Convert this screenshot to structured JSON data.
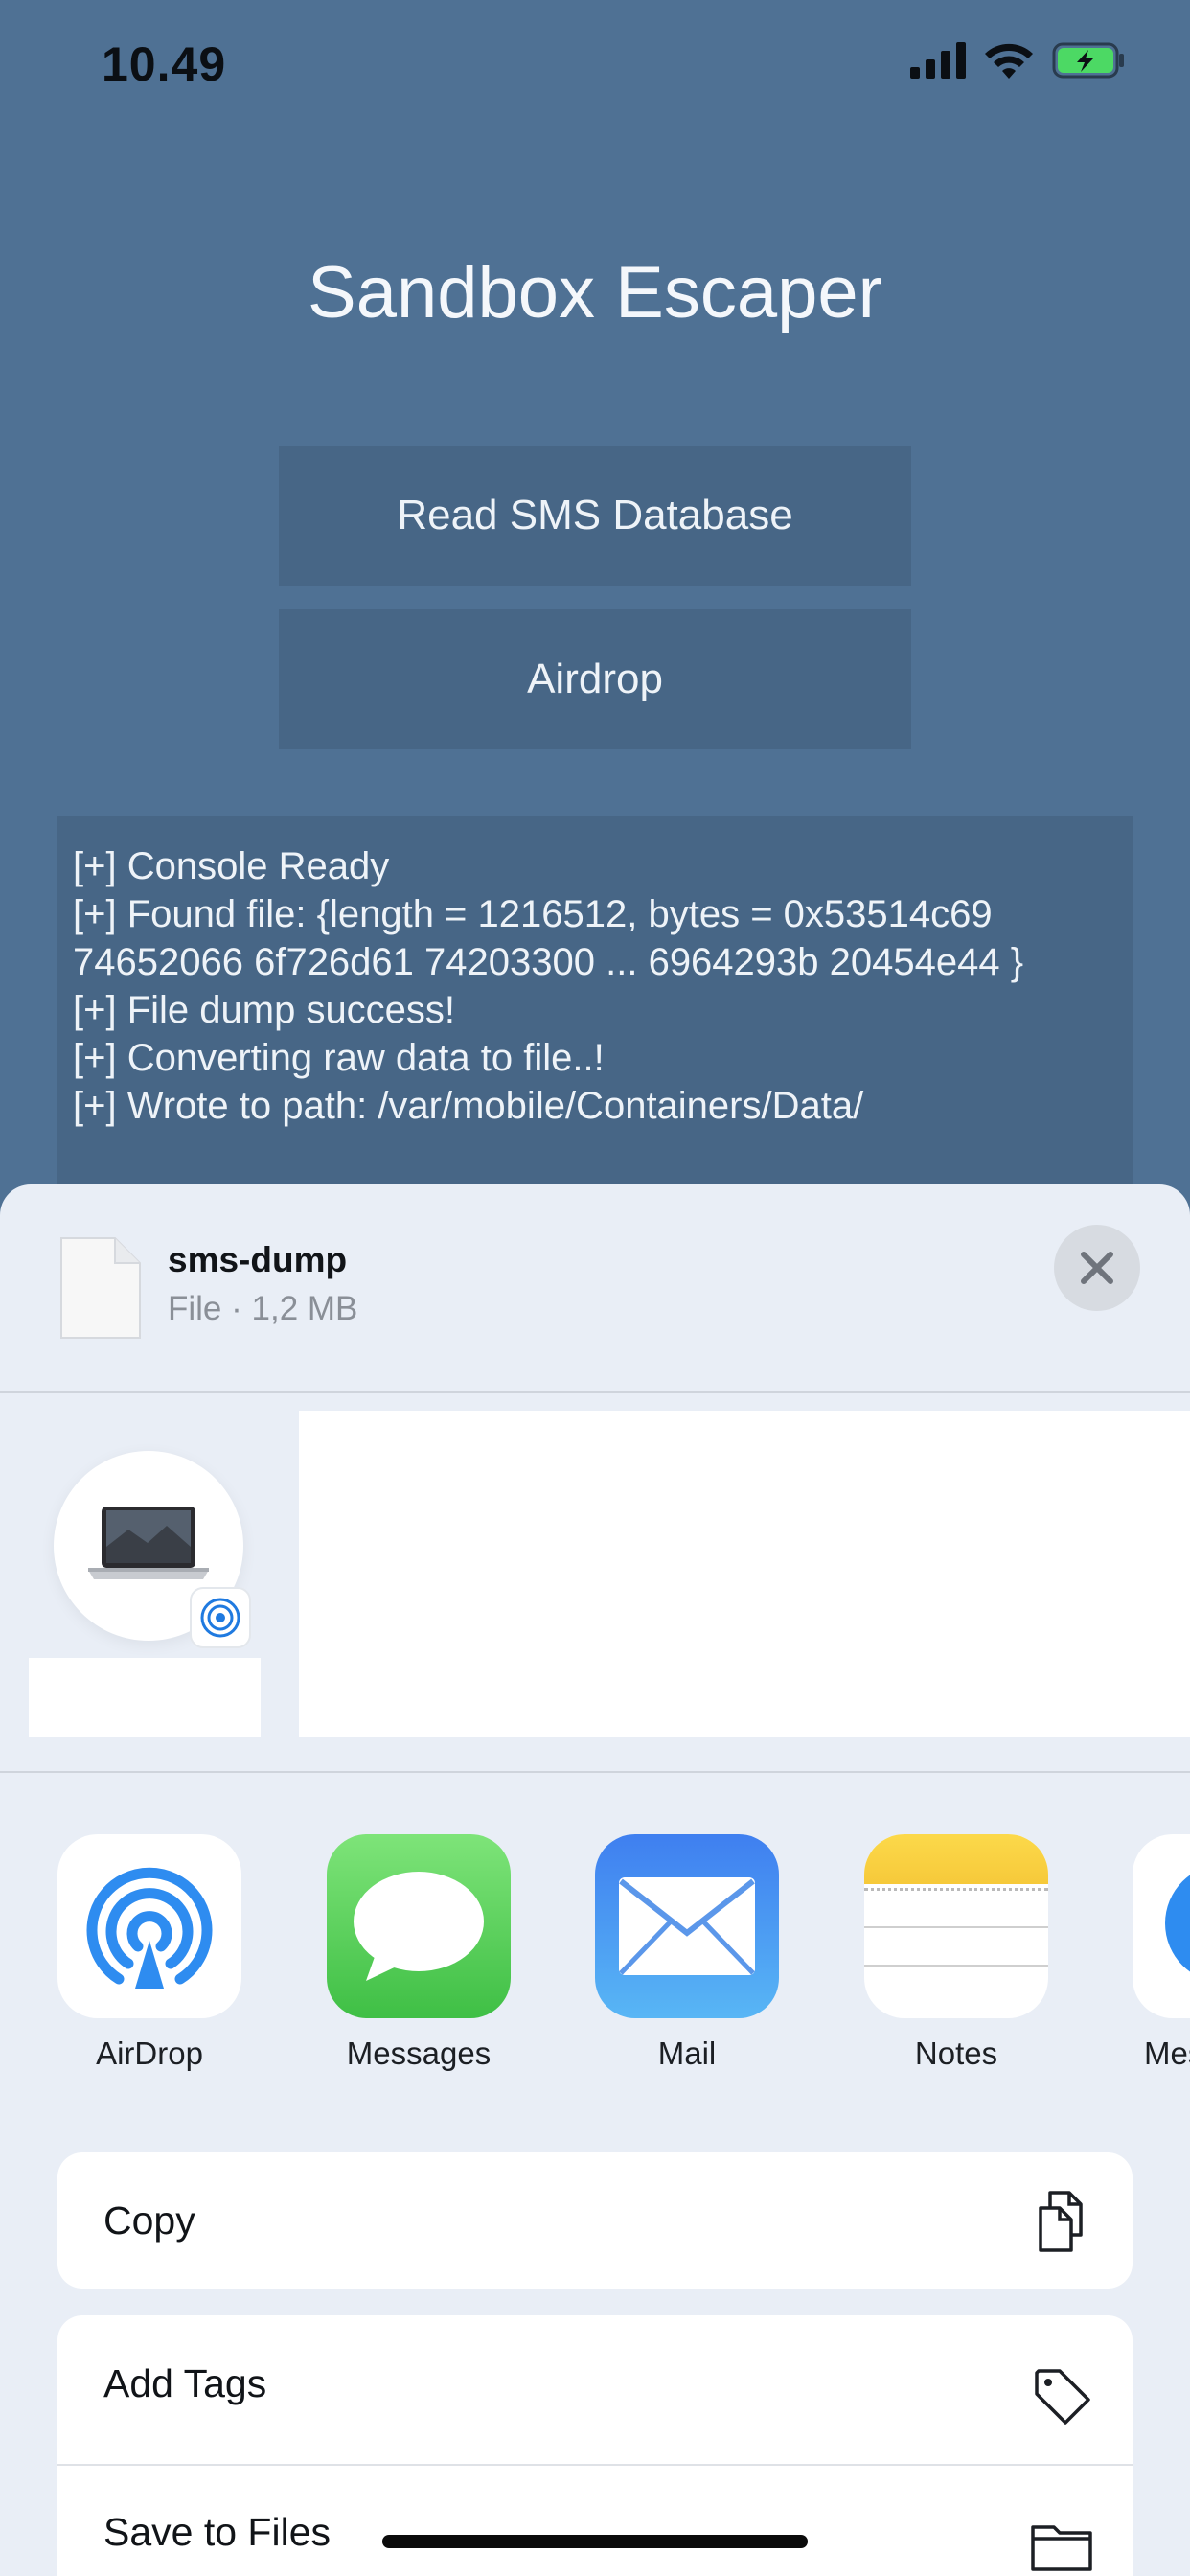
{
  "status_bar": {
    "time": "10.49",
    "icons": [
      "cellular-signal-icon",
      "wifi-icon",
      "battery-charging-icon"
    ],
    "battery_color": "#4cd964"
  },
  "app": {
    "title": "Sandbox Escaper",
    "buttons": {
      "read_sms": "Read SMS Database",
      "airdrop": "Airdrop"
    },
    "console_lines": [
      "[+] Console Ready",
      "[+] Found file: {length = 1216512, bytes = 0x53514c69 74652066 6f726d61 74203300 ... 6964293b 20454e44 }",
      "[+] File dump success!",
      "[+] Converting raw data to file..!",
      "[+] Wrote to path: /var/mobile/Containers/Data/"
    ],
    "background_color": "#4f7194"
  },
  "share_sheet": {
    "file": {
      "name": "sms-dump",
      "meta": "File · 1,2 MB"
    },
    "apps": [
      {
        "label": "AirDrop",
        "icon": "airdrop-icon"
      },
      {
        "label": "Messages",
        "icon": "messages-icon"
      },
      {
        "label": "Mail",
        "icon": "mail-icon"
      },
      {
        "label": "Notes",
        "icon": "notes-icon"
      },
      {
        "label": "Mes",
        "icon": "messenger-icon"
      }
    ],
    "actions": [
      {
        "label": "Copy",
        "icon": "copy-icon"
      },
      {
        "label": "Add Tags",
        "icon": "tag-icon"
      },
      {
        "label": "Save to Files",
        "icon": "folder-icon"
      }
    ]
  }
}
